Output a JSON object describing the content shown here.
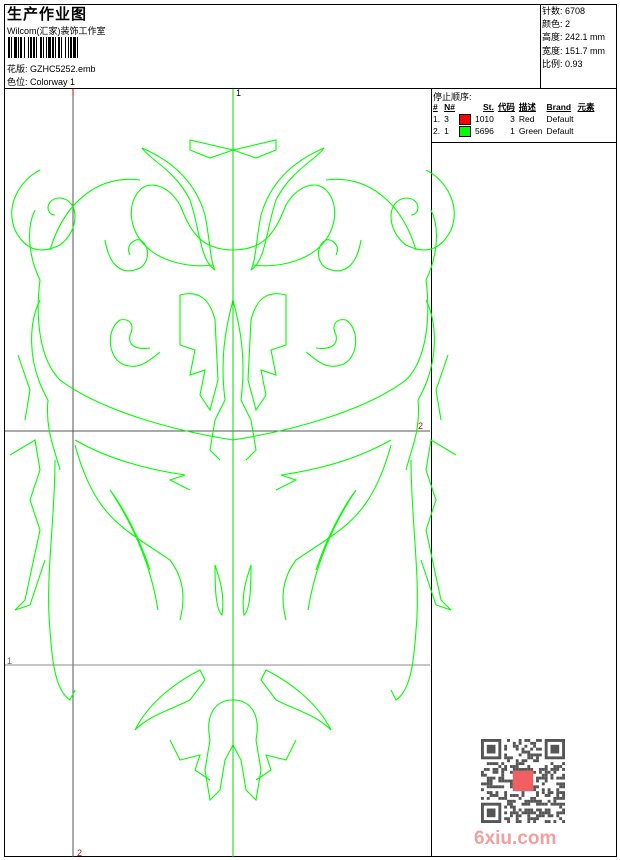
{
  "header": {
    "title": "生产作业图",
    "company": "Wilcom(汇家)装饰工作室",
    "design_label": "花版:",
    "design_file": "GZHC5252.emb",
    "colorway_label": "色位:",
    "colorway": "Colorway 1"
  },
  "stats": {
    "stitches": "针数: 6708",
    "colors": "颜色: 2",
    "height": "高度: 242.1 mm",
    "width": "宽度: 151.7 mm",
    "scale": "比例: 0.93"
  },
  "stop_sequence": {
    "title": "停止顺序:",
    "columns": [
      "#",
      "N#",
      "",
      "St.",
      "代码",
      "描述",
      "Brand",
      "元素"
    ],
    "rows": [
      {
        "index": "1.",
        "needle": "3",
        "color": "#ff0000",
        "stitches": "1010",
        "code": "3",
        "description": "Red",
        "brand": "Default",
        "element": ""
      },
      {
        "index": "2.",
        "needle": "1",
        "color": "#00ff00",
        "stitches": "5696",
        "code": "1",
        "description": "Green",
        "brand": "Default",
        "element": ""
      }
    ]
  },
  "canvas": {
    "guide_labels": {
      "top_vertical": "1",
      "bottom_vertical": "2",
      "right_horizontal": "2",
      "left_horizontal": "1"
    },
    "design_color": "#00ff00"
  },
  "watermark": "6xiu.com"
}
